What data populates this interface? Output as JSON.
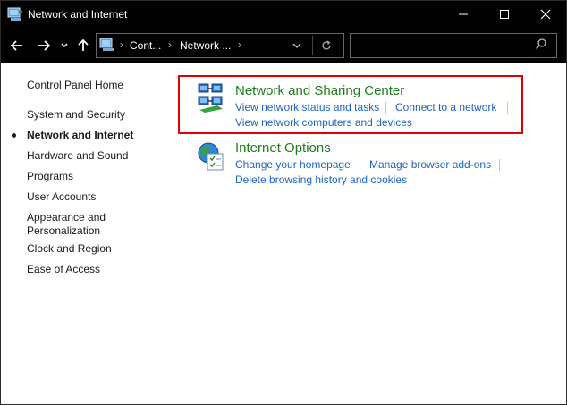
{
  "window": {
    "title": "Network and Internet"
  },
  "nav": {
    "breadcrumb": [
      "Cont...",
      "Network ..."
    ],
    "search_placeholder": ""
  },
  "sidebar": {
    "home": "Control Panel Home",
    "items": [
      {
        "label": "System and Security",
        "current": false
      },
      {
        "label": "Network and Internet",
        "current": true
      },
      {
        "label": "Hardware and Sound",
        "current": false
      },
      {
        "label": "Programs",
        "current": false
      },
      {
        "label": "User Accounts",
        "current": false
      },
      {
        "label": "Appearance and",
        "label2": "Personalization",
        "current": false
      },
      {
        "label": "Clock and Region",
        "current": false
      },
      {
        "label": "Ease of Access",
        "current": false
      }
    ]
  },
  "categories": [
    {
      "title": "Network and Sharing Center",
      "icon": "network-icon",
      "links": [
        "View network status and tasks",
        "Connect to a network",
        "View network computers and devices"
      ],
      "highlighted": true
    },
    {
      "title": "Internet Options",
      "icon": "globe-icon",
      "links": [
        "Change your homepage",
        "Manage browser add-ons",
        "Delete browsing history and cookies"
      ],
      "highlighted": false
    }
  ],
  "colors": {
    "category_title": "#1e7f1e",
    "link": "#1c64c8",
    "highlight_border": "#e00000"
  }
}
